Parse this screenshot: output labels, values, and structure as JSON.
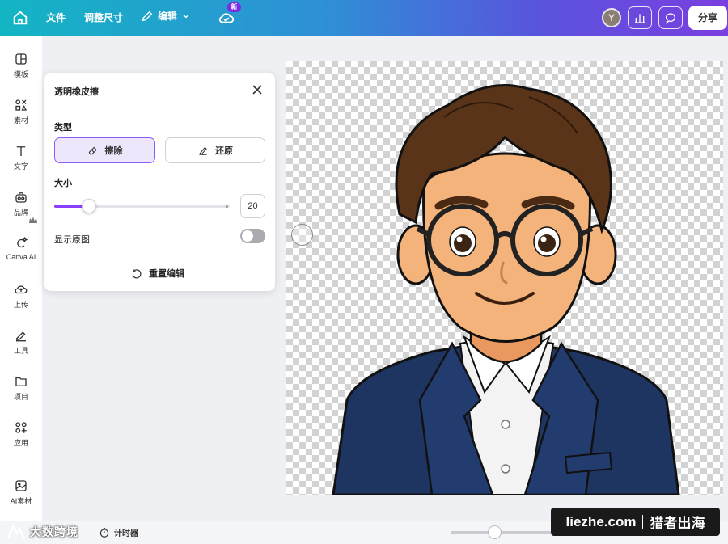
{
  "topbar": {
    "file_label": "文件",
    "resize_label": "调整尺寸",
    "edit_label": "编辑",
    "new_badge": "新",
    "avatar_initial": "Y",
    "share_label": "分享"
  },
  "sidebar": {
    "items": [
      {
        "label": "模板",
        "icon": "template-icon"
      },
      {
        "label": "素材",
        "icon": "elements-icon"
      },
      {
        "label": "文字",
        "icon": "text-icon"
      },
      {
        "label": "品牌",
        "icon": "brand-icon"
      },
      {
        "label": "Canva AI",
        "icon": "canva-ai-icon"
      },
      {
        "label": "上传",
        "icon": "upload-icon"
      },
      {
        "label": "工具",
        "icon": "tools-icon"
      },
      {
        "label": "项目",
        "icon": "folder-icon"
      },
      {
        "label": "应用",
        "icon": "apps-icon"
      },
      {
        "label": "AI素材",
        "icon": "ai-image-icon"
      }
    ]
  },
  "panel": {
    "title": "透明橡皮擦",
    "type_label": "类型",
    "erase_label": "擦除",
    "restore_label": "还原",
    "size_label": "大小",
    "size_value": "20",
    "size_fraction": 0.2,
    "show_original_label": "显示原图",
    "show_original_on": false,
    "reset_label": "重置编辑"
  },
  "bottombar": {
    "brand_text": "大数跨境",
    "timer_label": "计时器",
    "zoom_fraction": 0.43
  },
  "watermark": {
    "left": "liezhe.com",
    "right": "猎者出海"
  },
  "colors": {
    "accent": "#8b3dff",
    "suit": "#1e3461",
    "skin": "#f4b37a",
    "hair": "#5a3418"
  }
}
